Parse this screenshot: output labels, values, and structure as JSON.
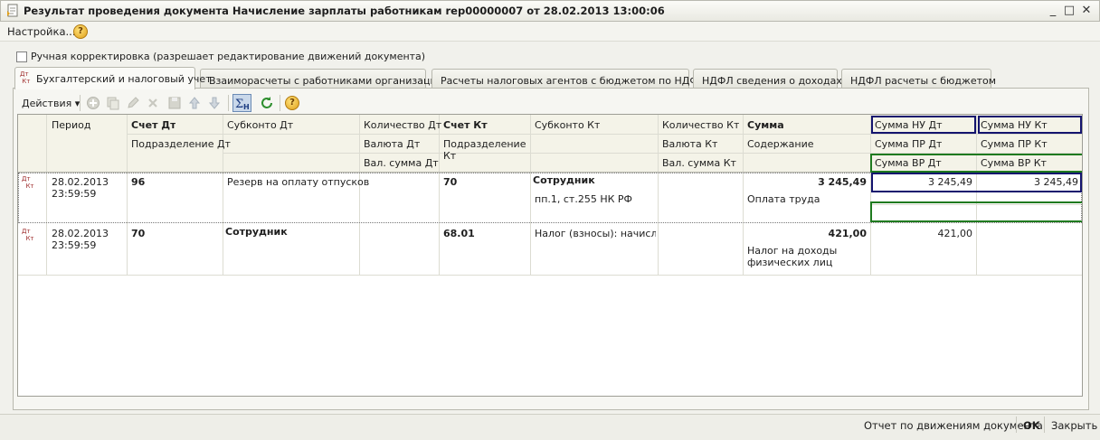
{
  "window": {
    "title": "Результат проведения документа Начисление зарплаты работникам rep00000007 от 28.02.2013 13:00:06",
    "minimize": "_",
    "maximize": "□",
    "close": "✕"
  },
  "menu": {
    "settings_label": "Настройка...",
    "help_label": "?"
  },
  "manual_correction": {
    "label": "Ручная корректировка (разрешает редактирование движений документа)",
    "checked": false
  },
  "tabs": [
    {
      "label": "Бухгалтерский и налоговый учет",
      "active": true
    },
    {
      "label": "Взаиморасчеты с работниками организаций",
      "active": false
    },
    {
      "label": "Расчеты налоговых агентов с бюджетом по НДФЛ",
      "active": false
    },
    {
      "label": "НДФЛ сведения о доходах",
      "active": false
    },
    {
      "label": "НДФЛ расчеты с бюджетом",
      "active": false
    }
  ],
  "toolbar": {
    "actions_label": "Действия",
    "icons": [
      "add-icon",
      "copy-icon",
      "edit-icon",
      "delete-icon",
      "save-icon",
      "move-up-icon",
      "move-down-icon",
      "sum-icon",
      "refresh-icon",
      "help-icon"
    ]
  },
  "grid": {
    "headers": {
      "period": "Период",
      "debit_account": "Счет Дт",
      "debit_division": "Подразделение Дт",
      "subconto_dt": "Субконто Дт",
      "qty_dt": "Количество Дт",
      "currency_dt": "Валюта Дт",
      "cur_sum_dt": "Вал. сумма Дт",
      "credit_account": "Счет Кт",
      "credit_division": "Подразделение Кт",
      "subconto_kt": "Субконто Кт",
      "qty_kt": "Количество Кт",
      "currency_kt": "Валюта Кт",
      "cur_sum_kt": "Вал. сумма Кт",
      "sum": "Сумма",
      "content": "Содержание",
      "nu_dt": "Сумма НУ Дт",
      "nu_kt": "Сумма НУ Кт",
      "pr_dt": "Сумма ПР Дт",
      "pr_kt": "Сумма ПР Кт",
      "vr_dt": "Сумма ВР Дт",
      "vr_kt": "Сумма ВР Кт"
    },
    "rows": [
      {
        "icon": "Дт/Кт",
        "date": "28.02.2013",
        "time": "23:59:59",
        "debit_account": "96",
        "subconto_dt": "Резерв на оплату отпусков",
        "credit_account": "70",
        "subconto_kt_1": "Сотрудник",
        "subconto_kt_2": "пп.1, ст.255 НК РФ",
        "sum": "3 245,49",
        "content": "Оплата труда",
        "nu_dt": "3 245,49",
        "nu_kt": "3 245,49"
      },
      {
        "icon": "Дт/Кт",
        "date": "28.02.2013",
        "time": "23:59:59",
        "debit_account": "70",
        "subconto_dt": "Сотрудник",
        "credit_account": "68.01",
        "subconto_kt_1": "Налог (взносы): начисл...",
        "sum": "421,00",
        "content_1": "Налог на доходы",
        "content_2": "физических лиц",
        "nu_dt": "421,00"
      }
    ]
  },
  "footer": {
    "report_label": "Отчет по движениям документа",
    "ok_label": "OK",
    "close_label": "Закрыть"
  }
}
